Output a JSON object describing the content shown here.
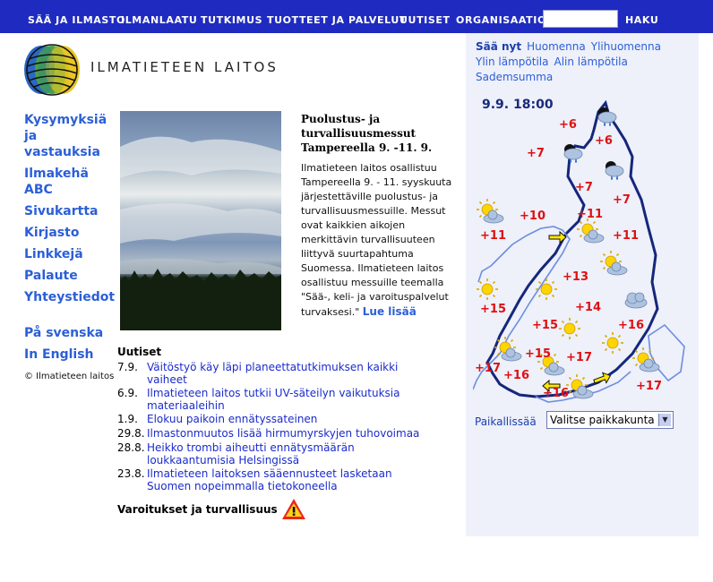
{
  "top_nav": {
    "items": [
      "SÄÄ JA ILMASTO",
      "ILMANLAATU",
      "TUTKIMUS",
      "TUOTTEET JA PALVELUT",
      "UUTISET",
      "ORGANISAATIO"
    ],
    "search_button": "HAKU"
  },
  "logo": {
    "text": "ILMATIETEEN LAITOS"
  },
  "left_nav": {
    "items": [
      "Kysymyksiä ja vastauksia",
      "Ilmakehä ABC",
      "Sivukartta",
      "Kirjasto",
      "Linkkejä",
      "Palaute",
      "Yhteystiedot"
    ],
    "languages": [
      "På svenska",
      "In English"
    ],
    "copyright": "© Ilmatieteen laitos"
  },
  "feature": {
    "title": "Puolustus- ja turvallisuusmessut Tampereella 9. -11. 9.",
    "body": "Ilmatieteen laitos osallistuu Tampereella 9. - 11. syyskuuta järjestettäville puolustus- ja turvallisuusmessuille. Messut ovat kaikkien aikojen merkittävin turvallisuuteen liittyvä suurtapahtuma Suomessa. Ilmatieteen laitos osallistuu messuille teemalla \"Sää-, keli- ja varoituspalvelut turvaksesi.\"",
    "read_more": "Lue lisää"
  },
  "news": {
    "title": "Uutiset",
    "items": [
      {
        "date": "7.9.",
        "text": "Väitöstyö käy läpi planeettatutkimuksen kaikki vaiheet"
      },
      {
        "date": "6.9.",
        "text": "Ilmatieteen laitos tutkii UV-säteilyn vaikutuksia materiaaleihin"
      },
      {
        "date": "1.9.",
        "text": "Elokuu paikoin ennätyssateinen"
      },
      {
        "date": "29.8.",
        "text": "Ilmastonmuutos lisää hirmumyrskyjen tuhovoimaa"
      },
      {
        "date": "28.8.",
        "text": "Heikko trombi aiheutti ennätysmäärän loukkaantumisia Helsingissä"
      },
      {
        "date": "23.8.",
        "text": "Ilmatieteen laitoksen sääennusteet lasketaan Suomen nopeimmalla tietokoneella"
      }
    ]
  },
  "warnings": {
    "label": "Varoitukset ja turvallisuus",
    "icon": "warning-triangle-icon"
  },
  "weather": {
    "tabs": [
      "Sää nyt",
      "Huomenna",
      "Ylihuomenna",
      "Ylin lämpötila",
      "Alin lämpötila",
      "Sademsumma"
    ],
    "active_tab": "Sää nyt",
    "time": "9.9. 18:00",
    "temperatures": [
      "+6",
      "+6",
      "+7",
      "+7",
      "+7",
      "+10",
      "+11",
      "+11",
      "+11",
      "+13",
      "+14",
      "+15",
      "+15",
      "+16",
      "+15",
      "+17",
      "+17",
      "+16",
      "+16",
      "+17"
    ],
    "local_label": "Paikallissää",
    "local_select": "Valitse paikkakunta"
  },
  "colors": {
    "nav_bg": "#1f2bc0",
    "link": "#2b5fd6",
    "temp": "#dd1111",
    "panel_bg": "#eef0fa"
  }
}
